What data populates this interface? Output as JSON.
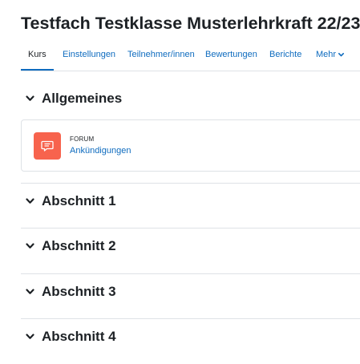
{
  "course": {
    "title": "Testfach Testklasse Musterlehrkraft 22/23"
  },
  "nav": {
    "tabs": [
      {
        "label": "Kurs",
        "active": true
      },
      {
        "label": "Einstellungen",
        "active": false
      },
      {
        "label": "Teilnehmer/innen",
        "active": false
      },
      {
        "label": "Bewertungen",
        "active": false
      },
      {
        "label": "Berichte",
        "active": false
      },
      {
        "label": "Mehr",
        "active": false,
        "has_dropdown": true
      }
    ]
  },
  "sections": [
    {
      "title": "Allgemeines",
      "expanded": true,
      "activities": [
        {
          "type": "FORUM",
          "name": "Ankündigungen",
          "icon": "forum-icon",
          "icon_color": "#f7634d"
        }
      ]
    },
    {
      "title": "Abschnitt 1",
      "expanded": true
    },
    {
      "title": "Abschnitt 2",
      "expanded": true
    },
    {
      "title": "Abschnitt 3",
      "expanded": true
    },
    {
      "title": "Abschnitt 4",
      "expanded": true
    }
  ],
  "colors": {
    "link": "#0f6cbf",
    "text": "#1d2125",
    "border": "#dee2e6"
  }
}
